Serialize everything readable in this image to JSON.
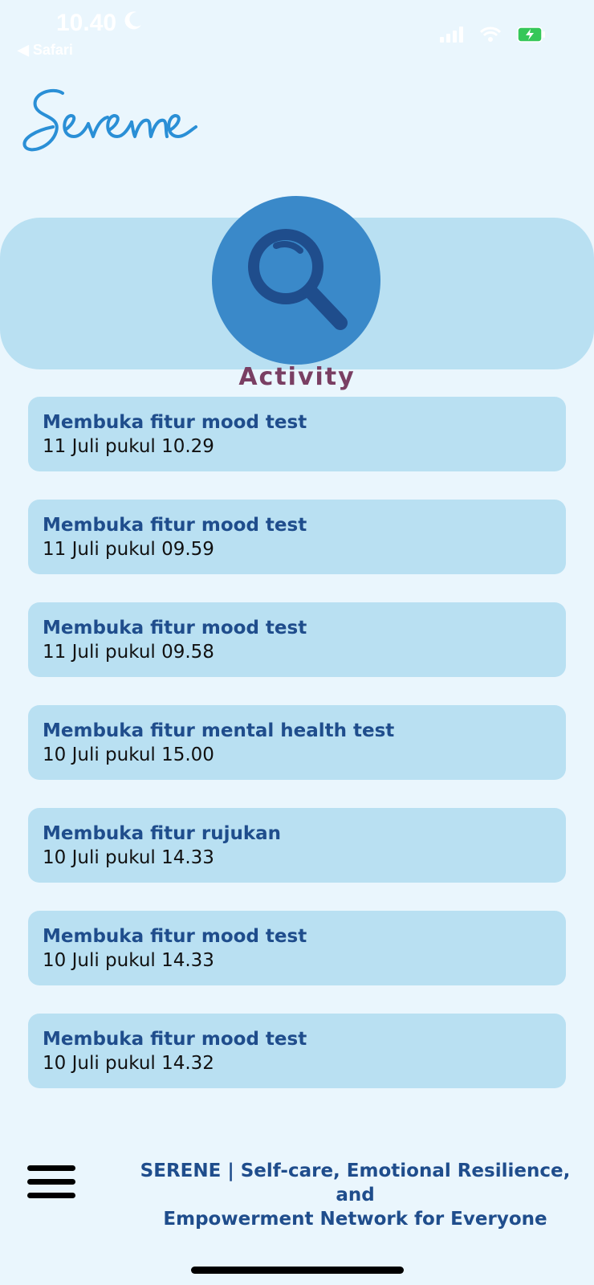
{
  "status_bar": {
    "time": "10.40",
    "back_app": "◀ Safari"
  },
  "app": {
    "logo_text": "Sereme"
  },
  "header": {
    "title": "Activity",
    "icon": "search-icon"
  },
  "activities": [
    {
      "title": "Membuka fitur mood test",
      "time": "11 Juli pukul 10.29"
    },
    {
      "title": "Membuka fitur mood test",
      "time": "11 Juli pukul 09.59"
    },
    {
      "title": "Membuka fitur mood test",
      "time": "11 Juli pukul 09.58"
    },
    {
      "title": "Membuka fitur mental health test",
      "time": "10 Juli pukul 15.00"
    },
    {
      "title": "Membuka fitur rujukan",
      "time": "10 Juli pukul 14.33"
    },
    {
      "title": "Membuka fitur mood test",
      "time": "10 Juli pukul 14.33"
    },
    {
      "title": "Membuka fitur mood test",
      "time": "10 Juli pukul 14.32"
    }
  ],
  "footer": {
    "line1": "SERENE | Self-care, Emotional Resilience, and",
    "line2": "Empowerment Network for Everyone",
    "menu_icon": "hamburger-menu-icon"
  },
  "colors": {
    "background": "#eaf6fd",
    "card": "#b9e0f2",
    "accent": "#3a89c9",
    "title_text": "#1f4d8c",
    "header_label": "#7a3f63"
  }
}
